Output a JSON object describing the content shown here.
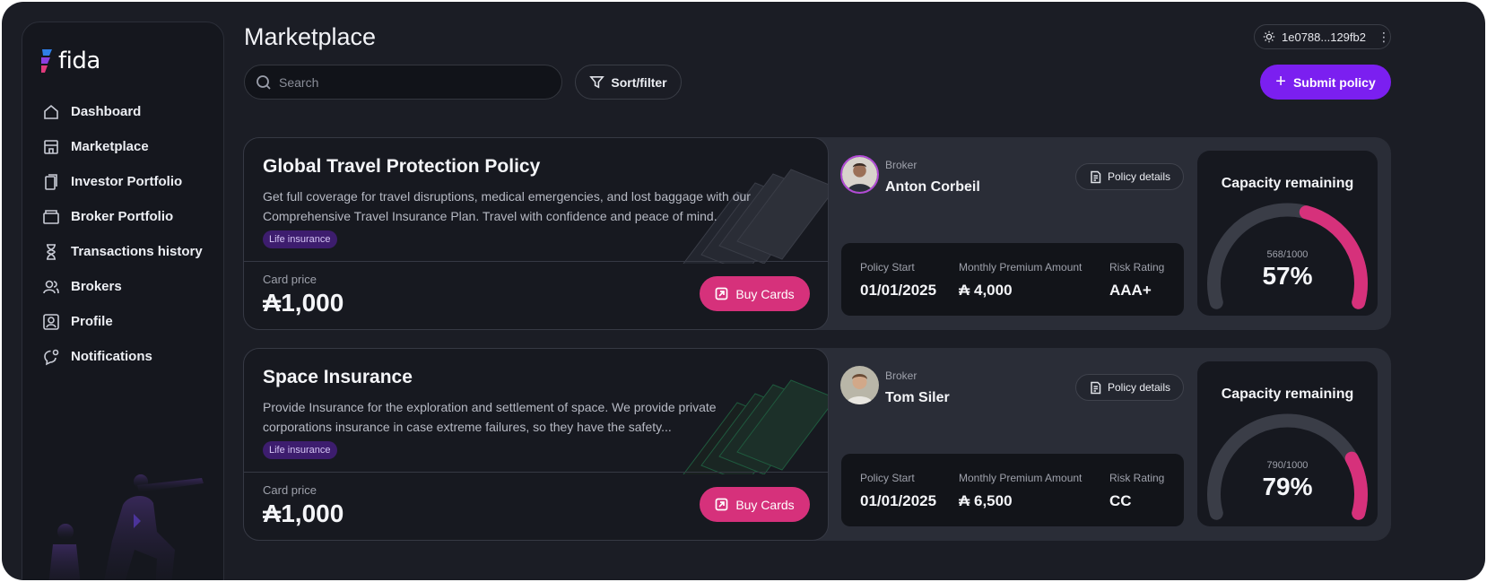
{
  "app": {
    "logo_text": "fida"
  },
  "sidebar": {
    "items": [
      {
        "label": "Dashboard",
        "icon": "home-icon"
      },
      {
        "label": "Marketplace",
        "icon": "store-icon"
      },
      {
        "label": "Investor Portfolio",
        "icon": "portfolio-icon"
      },
      {
        "label": "Broker Portfolio",
        "icon": "wallet-icon"
      },
      {
        "label": "Transactions history",
        "icon": "hourglass-icon"
      },
      {
        "label": "Brokers",
        "icon": "users-icon"
      },
      {
        "label": "Profile",
        "icon": "profile-icon"
      },
      {
        "label": "Notifications",
        "icon": "chat-bell-icon"
      }
    ]
  },
  "header": {
    "title": "Marketplace",
    "search_placeholder": "Search",
    "sort_label": "Sort/filter",
    "wallet_address": "1e0788...129fb2",
    "submit_label": "Submit policy"
  },
  "colors": {
    "accent_purple": "#7b1ff0",
    "accent_pink": "#d6317b",
    "background": "#1b1d25"
  },
  "policies": [
    {
      "title": "Global Travel Protection Policy",
      "description": "Get full coverage for travel disruptions, medical emergencies, and lost baggage with our Comprehensive Travel Insurance Plan. Travel with confidence and peace of mind.",
      "tag": "Life insurance",
      "price_label": "Card price",
      "price": "₳1,000",
      "buy_label": "Buy Cards",
      "broker_label": "Broker",
      "broker_name": "Anton Corbeil",
      "details_label": "Policy details",
      "stats": {
        "start_label": "Policy Start",
        "start_value": "01/01/2025",
        "premium_label": "Monthly Premium Amount",
        "premium_value": "₳ 4,000",
        "risk_label": "Risk Rating",
        "risk_value": "AAA+"
      },
      "capacity_title": "Capacity remaining",
      "capacity_ratio": "568/1000",
      "capacity_percent": "57%",
      "capacity_fraction": 0.57
    },
    {
      "title": "Space Insurance",
      "description": "Provide Insurance for the exploration and settlement of space. We provide private corporations insurance in case extreme failures, so they have the safety...",
      "tag": "Life insurance",
      "price_label": "Card price",
      "price": "₳1,000",
      "buy_label": "Buy Cards",
      "broker_label": "Broker",
      "broker_name": "Tom Siler",
      "details_label": "Policy details",
      "stats": {
        "start_label": "Policy Start",
        "start_value": "01/01/2025",
        "premium_label": "Monthly Premium Amount",
        "premium_value": "₳ 6,500",
        "risk_label": "Risk Rating",
        "risk_value": "CC"
      },
      "capacity_title": "Capacity remaining",
      "capacity_ratio": "790/1000",
      "capacity_percent": "79%",
      "capacity_fraction": 0.79
    }
  ]
}
